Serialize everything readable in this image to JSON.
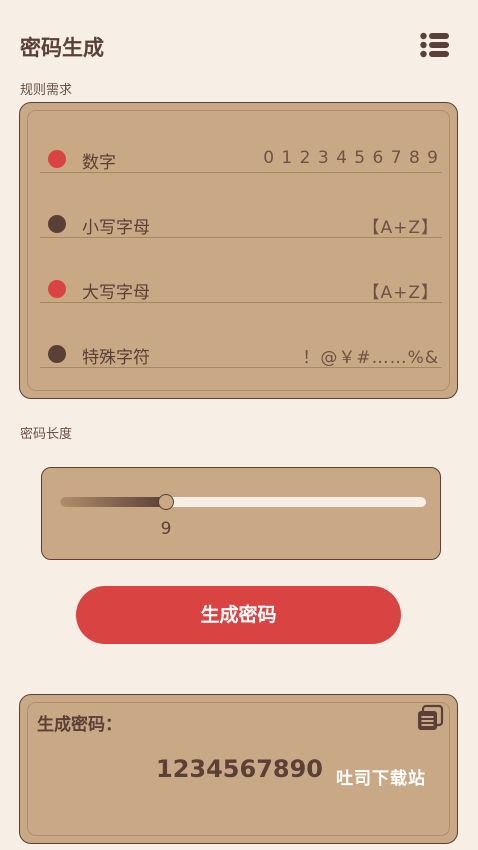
{
  "header": {
    "title": "密码生成",
    "menu_icon": "list-menu-icon"
  },
  "rules_section": {
    "label": "规则需求",
    "rules": [
      {
        "name": "数字",
        "chars": "0 1 2 3 4 5 6 7 8 9",
        "active": true
      },
      {
        "name": "小写字母",
        "chars": "【A+Z】",
        "active": false
      },
      {
        "name": "大写字母",
        "chars": "【A+Z】",
        "active": true
      },
      {
        "name": "特殊字符",
        "chars": "！@￥#……%&",
        "active": false
      }
    ]
  },
  "length_section": {
    "label": "密码长度",
    "value": "9",
    "fill_fraction": 0.29
  },
  "generate_button": {
    "label": "生成密码"
  },
  "result": {
    "label": "生成密码：",
    "value": "1234567890",
    "copy_icon": "copy-icon"
  },
  "watermark": "吐司下载站",
  "colors": {
    "accent_red": "#d94442",
    "dark_brown": "#5a4036",
    "card_tan": "#c9a985",
    "background": "#f7efe5"
  }
}
